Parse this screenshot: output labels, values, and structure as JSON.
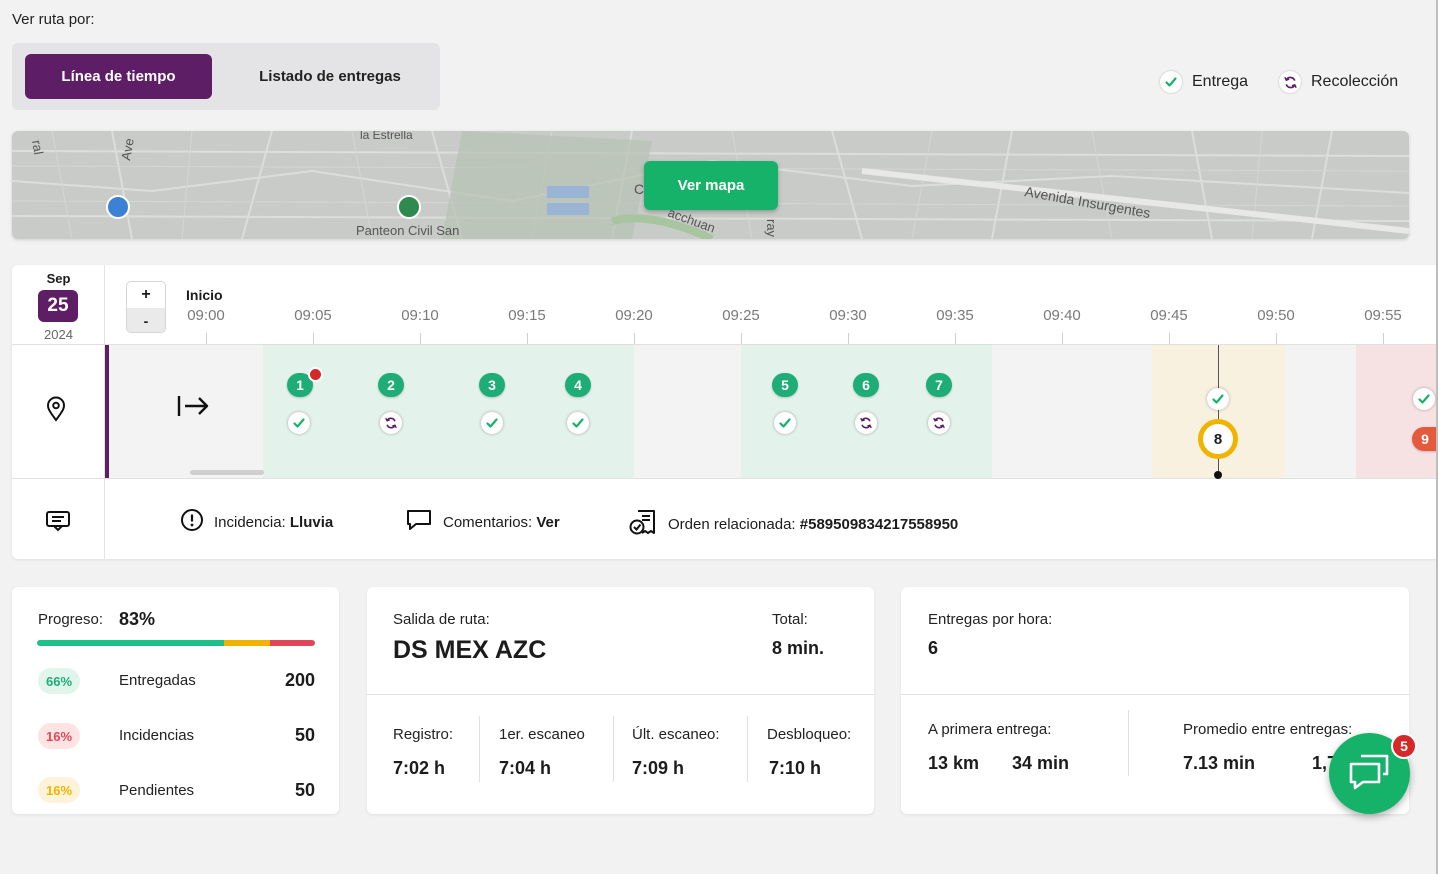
{
  "header": {
    "view_label": "Ver ruta por:",
    "tabs": [
      {
        "label": "Línea de tiempo",
        "active": true
      },
      {
        "label": "Listado de entregas",
        "active": false
      }
    ],
    "legend": {
      "delivery": "Entrega",
      "pickup": "Recolección"
    }
  },
  "map": {
    "button": "Ver mapa",
    "labels": [
      "la Estrella",
      "Panteon Civil San",
      "Avenida Insurgentes",
      "Ave",
      "ral",
      "acchuan",
      "ray",
      "C"
    ]
  },
  "timeline": {
    "month": "Sep",
    "day": "25",
    "year": "2024",
    "zoom_in": "+",
    "zoom_out": "-",
    "start_label": "Inicio",
    "ticks": [
      "09:00",
      "09:05",
      "09:10",
      "09:15",
      "09:20",
      "09:25",
      "09:30",
      "09:35",
      "09:40",
      "09:45",
      "09:50",
      "09:55"
    ],
    "stops": [
      {
        "n": "1",
        "type": "delivery",
        "alert": true
      },
      {
        "n": "2",
        "type": "pickup"
      },
      {
        "n": "3",
        "type": "delivery"
      },
      {
        "n": "4",
        "type": "delivery"
      },
      {
        "n": "5",
        "type": "delivery"
      },
      {
        "n": "6",
        "type": "pickup"
      },
      {
        "n": "7",
        "type": "pickup"
      },
      {
        "n": "8",
        "type": "delivery",
        "current": true
      },
      {
        "n": "9",
        "type": "delivery",
        "incident": true
      }
    ],
    "incidence_label": "Incidencia:",
    "incidence_value": "Lluvia",
    "comments_label": "Comentarios:",
    "comments_value": "Ver",
    "order_label": "Orden relacionada:",
    "order_value": "#589509834217558950"
  },
  "progress": {
    "label": "Progreso:",
    "value": "83%",
    "bar": [
      66,
      16,
      16
    ],
    "rows": [
      {
        "pct": "66%",
        "label": "Entregadas",
        "count": "200",
        "bg": "#e2f5ec",
        "fg": "#1fad77"
      },
      {
        "pct": "16%",
        "label": "Incidencias",
        "count": "50",
        "bg": "#fde3e3",
        "fg": "#e0485a"
      },
      {
        "pct": "16%",
        "label": "Pendientes",
        "count": "50",
        "bg": "#fdf3d8",
        "fg": "#f0b400"
      }
    ]
  },
  "route": {
    "departure_label": "Salida de ruta:",
    "departure_value": "DS MEX AZC",
    "total_label": "Total:",
    "total_value": "8 min.",
    "items": [
      {
        "label": "Registro:",
        "value": "7:02 h"
      },
      {
        "label": "1er. escaneo",
        "value": "7:04 h"
      },
      {
        "label": "Últ. escaneo:",
        "value": "7:09 h"
      },
      {
        "label": "Desbloqueo:",
        "value": "7:10 h"
      }
    ]
  },
  "deliveries": {
    "per_hour_label": "Entregas por hora:",
    "per_hour_value": "6",
    "first_label": "A primera entrega:",
    "first_km": "13 km",
    "first_min": "34 min",
    "avg_label": "Promedio entre entregas:",
    "avg_min": "7.13 min",
    "avg_km": "1,7"
  },
  "chat": {
    "badge": "5"
  },
  "colors": {
    "brand": "#5e1e66",
    "green": "#17b26a",
    "yellow": "#f0b400",
    "red": "#e0485a"
  }
}
